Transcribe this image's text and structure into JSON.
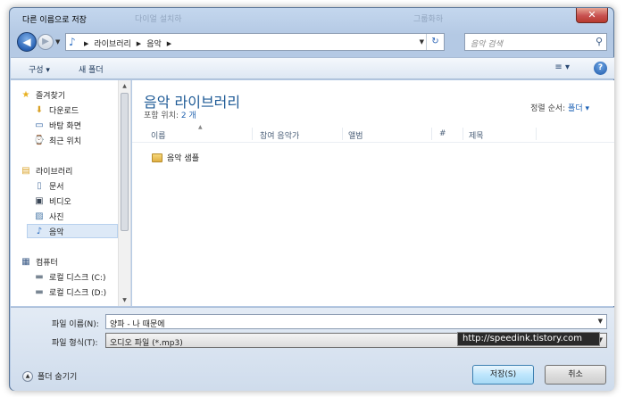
{
  "window": {
    "title": "다른 이름으로 저장",
    "ghost_texts": [
      "다이얼 설치하",
      "그룹화하"
    ],
    "close_icon": "✕"
  },
  "nav": {
    "breadcrumb": [
      "라이브러리",
      "음악"
    ],
    "search_placeholder": "음악 검색"
  },
  "toolbar": {
    "organize": "구성 ▾",
    "new_folder": "새 폴더",
    "views_icon": "≡ ▾",
    "help": "?"
  },
  "sidebar": {
    "items": [
      {
        "label": "즐겨찾기",
        "icon": "★"
      },
      {
        "label": "다운로드",
        "icon": "⬇"
      },
      {
        "label": "바탕 화면",
        "icon": "▭"
      },
      {
        "label": "최근 위치",
        "icon": "⌚"
      },
      {
        "label": "라이브러리",
        "icon": "▤"
      },
      {
        "label": "문서",
        "icon": "▯"
      },
      {
        "label": "비디오",
        "icon": "▣"
      },
      {
        "label": "사진",
        "icon": "▨"
      },
      {
        "label": "음악",
        "icon": "♪"
      },
      {
        "label": "컴퓨터",
        "icon": "▦"
      },
      {
        "label": "로컬 디스크 (C:)",
        "icon": "▬"
      },
      {
        "label": "로컬 디스크 (D:)",
        "icon": "▬"
      }
    ]
  },
  "content": {
    "library_title": "음악 라이브러리",
    "includes_label": "포함 위치:",
    "includes_value": "2 개",
    "sort_label": "정렬 순서:",
    "sort_value": "폴더 ▾",
    "columns": [
      "이름",
      "참여 음악가",
      "앨범",
      "#",
      "제목"
    ],
    "items": [
      {
        "name": "음악 샘플"
      }
    ]
  },
  "form": {
    "filename_label": "파일 이름(N):",
    "filename_value": "양파 - 나 때문에",
    "filetype_label": "파일 형식(T):",
    "filetype_value": "오디오 파일 (*.mp3)",
    "hide_folders": "폴더 숨기기",
    "save": "저장(S)",
    "cancel": "취소"
  },
  "watermark": "http://speedink.tistory.com"
}
